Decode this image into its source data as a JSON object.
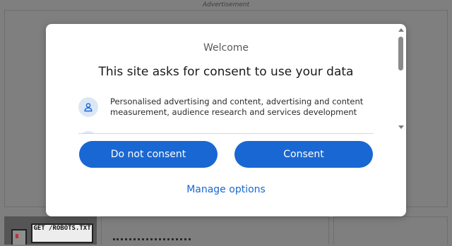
{
  "background": {
    "ad_label": "Advertisement",
    "thumbnail_sign_text": "GET /ROBOTS.TXT"
  },
  "modal": {
    "header": "Welcome",
    "title": "This site asks for consent to use your data",
    "purposes": [
      {
        "icon": "person-icon",
        "text": "Personalised advertising and content, advertising and content measurement, audience research and services development"
      }
    ],
    "buttons": {
      "deny_label": "Do not consent",
      "consent_label": "Consent"
    },
    "manage_label": "Manage options"
  },
  "colors": {
    "accent": "#1967d2",
    "icon_circle": "#dbe7f6",
    "overlay": "#7f7f7f"
  }
}
